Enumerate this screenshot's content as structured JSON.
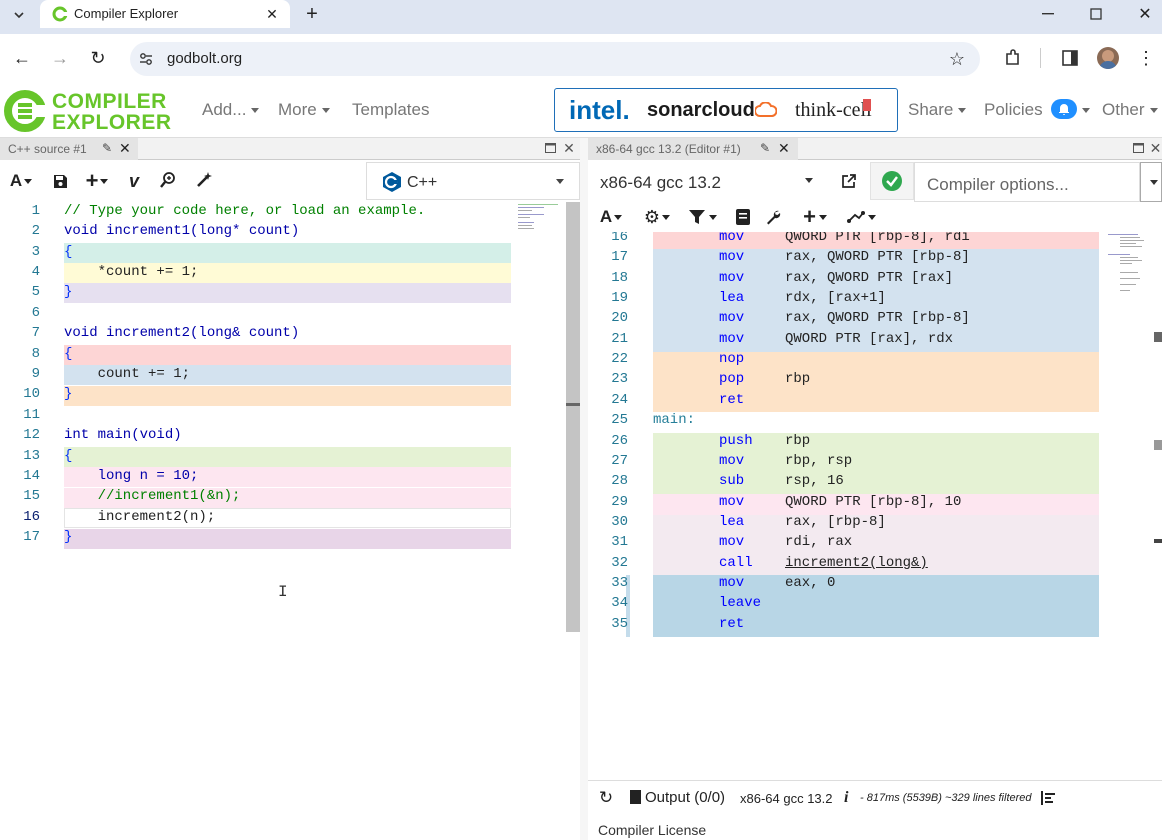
{
  "browser": {
    "tab_title": "Compiler Explorer",
    "url": "godbolt.org"
  },
  "ce": {
    "logo_top": "COMPILER",
    "logo_bottom": "EXPLORER",
    "menu": {
      "add": "Add...",
      "more": "More",
      "templates": "Templates",
      "share": "Share",
      "policies": "Policies",
      "other": "Other"
    },
    "sponsors": [
      "intel.",
      "sonarcloud",
      "think-cell"
    ]
  },
  "source_pane": {
    "tab_title": "C++ source #1",
    "language": "C++",
    "lines": [
      "// Type your code here, or load an example.",
      "void increment1(long* count)",
      "{",
      "    *count += 1;",
      "}",
      "",
      "void increment2(long& count)",
      "{",
      "    count += 1;",
      "}",
      "",
      "int main(void)",
      "{",
      "    long n = 10;",
      "    //increment1(&n);",
      "    increment2(n);",
      "}"
    ]
  },
  "compiler_pane": {
    "tab_title": "x86-64 gcc 13.2 (Editor #1)",
    "compiler": "x86-64 gcc 13.2",
    "options_placeholder": "Compiler options...",
    "asm_lines": [
      {
        "n": "16",
        "op": "mov",
        "args": "QWORD PTR [rbp-8], rdi"
      },
      {
        "n": "17",
        "op": "mov",
        "args": "rax, QWORD PTR [rbp-8]"
      },
      {
        "n": "18",
        "op": "mov",
        "args": "rax, QWORD PTR [rax]"
      },
      {
        "n": "19",
        "op": "lea",
        "args": "rdx, [rax+1]"
      },
      {
        "n": "20",
        "op": "mov",
        "args": "rax, QWORD PTR [rbp-8]"
      },
      {
        "n": "21",
        "op": "mov",
        "args": "QWORD PTR [rax], rdx"
      },
      {
        "n": "22",
        "op": "nop",
        "args": ""
      },
      {
        "n": "23",
        "op": "pop",
        "args": "rbp"
      },
      {
        "n": "24",
        "op": "ret",
        "args": ""
      },
      {
        "n": "25",
        "label": "main:"
      },
      {
        "n": "26",
        "op": "push",
        "args": "rbp"
      },
      {
        "n": "27",
        "op": "mov",
        "args": "rbp, rsp"
      },
      {
        "n": "28",
        "op": "sub",
        "args": "rsp, 16"
      },
      {
        "n": "29",
        "op": "mov",
        "args": "QWORD PTR [rbp-8], 10"
      },
      {
        "n": "30",
        "op": "lea",
        "args": "rax, [rbp-8]"
      },
      {
        "n": "31",
        "op": "mov",
        "args": "rdi, rax"
      },
      {
        "n": "32",
        "op": "call",
        "args": "increment2(long&)"
      },
      {
        "n": "33",
        "op": "mov",
        "args": "eax, 0"
      },
      {
        "n": "34",
        "op": "leave",
        "args": ""
      },
      {
        "n": "35",
        "op": "ret",
        "args": ""
      }
    ],
    "status": {
      "output_label": "Output (0/0)",
      "compiler": "x86-64 gcc 13.2",
      "info_icon": "i",
      "timing": "- 817ms (5539B) ~329 lines filtered"
    },
    "license": "Compiler License"
  },
  "colors": {
    "yellow": "#fffbd6",
    "teal": "#d4efe8",
    "lavender": "#e6e0f0",
    "pink": "#fdd5d5",
    "blue": "#d3e2ef",
    "peach": "#fde3c8",
    "green": "#e5f2d4",
    "rose": "#fde6f0",
    "mauve": "#e8d5e8",
    "selected_blue": "#b8d6e6"
  }
}
